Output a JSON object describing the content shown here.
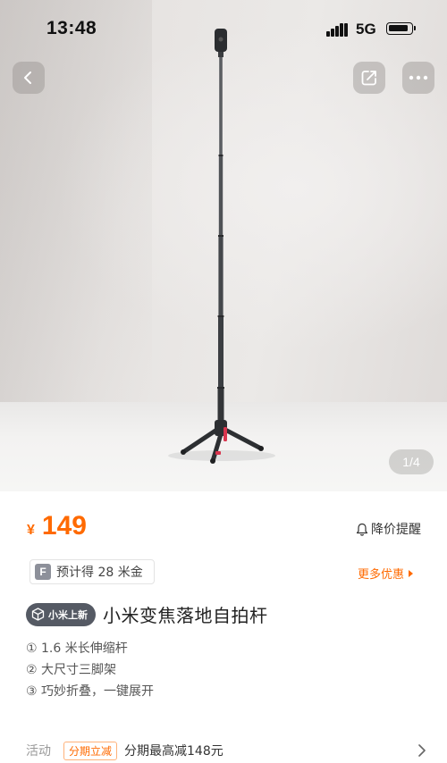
{
  "status_bar": {
    "time": "13:48",
    "network": "5G",
    "icons": [
      "signal-icon",
      "battery-icon"
    ]
  },
  "gallery": {
    "counter": "1/4",
    "controls": [
      "back-icon",
      "share-icon",
      "more-icon"
    ]
  },
  "product": {
    "currency": "¥",
    "price": "149",
    "price_alert_label": "降价提醒",
    "coins_badge": "F",
    "coins_text": "预计得 28 米金",
    "more_offers_label": "更多优惠",
    "new_badge_label": "小米上新",
    "title": "小米变焦落地自拍杆",
    "features": [
      "① 1.6 米长伸缩杆",
      "② 大尺寸三脚架",
      "③ 巧妙折叠，一键展开"
    ]
  },
  "activity": {
    "label": "活动",
    "tag": "分期立减",
    "description": "分期最高减148元"
  },
  "colors": {
    "accent": "#ff6a00",
    "badge_bg": "#555a64"
  }
}
